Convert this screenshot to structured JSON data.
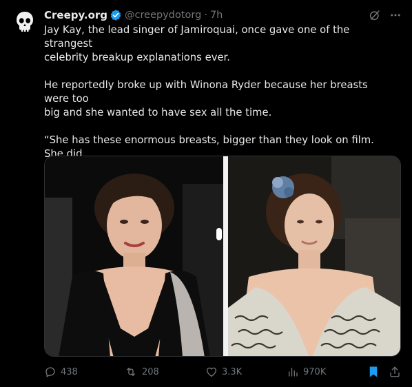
{
  "author": {
    "display_name": "Creepy.org",
    "handle": "@creepydotorg",
    "separator": "·",
    "time": "7h",
    "avatar_icon": "skull-icon",
    "verified_color": "#1d9bf0"
  },
  "tweet": {
    "paragraphs": [
      "Jay Kay, the lead singer of Jamiroquai, once gave one of the strangest\ncelebrity breakup explanations ever.",
      "He reportedly broke up with Winona Ryder because her breasts were too\nbig and she wanted to have sex all the time.",
      "“She has these enormous breasts, bigger than they look on film. She did\nhave this habit of constantly wanting to play hide the sausage. It was\nexhausting.”"
    ]
  },
  "media": {
    "photos": [
      "left-photo",
      "right-photo"
    ]
  },
  "actions": {
    "reply_count": "438",
    "repost_count": "208",
    "like_count": "3.3K",
    "views_count": "970K",
    "bookmark_color": "#1d9bf0"
  }
}
